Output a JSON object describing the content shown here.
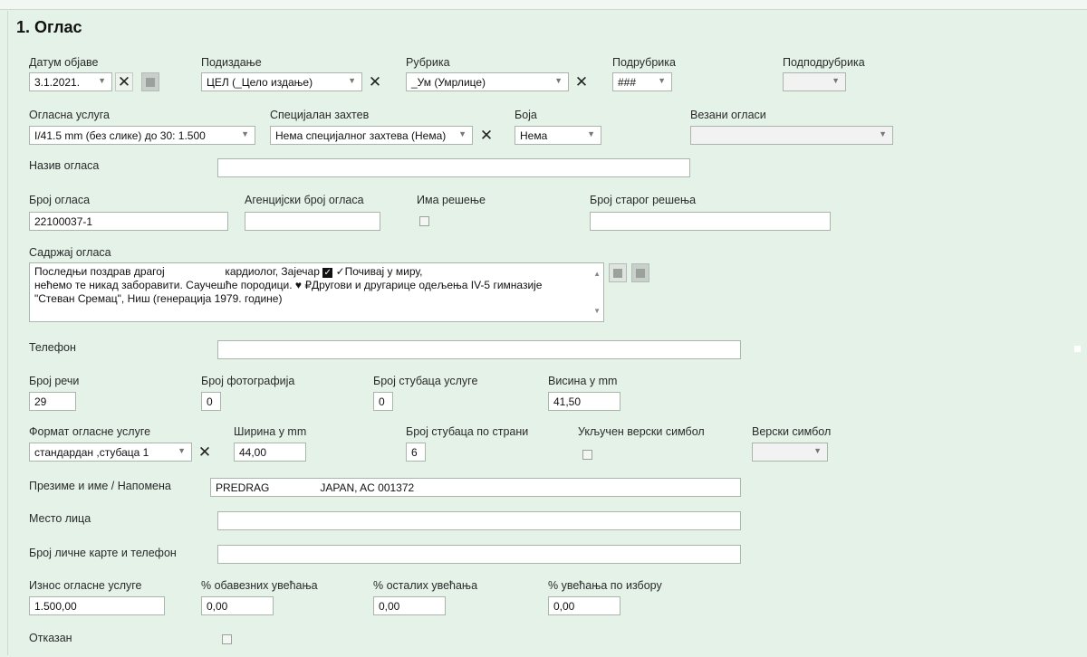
{
  "section": {
    "title": "1. Оглас"
  },
  "labels": {
    "datum_objave": "Датум објаве",
    "podizdanje": "Подиздање",
    "rubrika": "Рубрика",
    "podrubrika": "Подрубрика",
    "podpodrubrika": "Подподрубрика",
    "oglasna_usluga": "Огласна услуга",
    "specijalan_zahtev": "Специјалан захтев",
    "boja": "Боја",
    "vezani_oglasi": "Везани огласи",
    "naziv_oglasa": "Назив огласа",
    "broj_oglasa": "Број огласа",
    "agencijski_broj": "Агенцијски број огласа",
    "ima_resenje": "Има решење",
    "broj_starog_resenja": "Број старог решења",
    "sadrzaj_oglasa": "Садржај огласа",
    "telefon": "Телефон",
    "broj_reci": "Број речи",
    "broj_fotografija": "Број фотографија",
    "broj_stubaca_usluge": "Број стубаца услуге",
    "visina_mm": "Висина у mm",
    "format_oglasne_usluge": "Формат огласне услуге",
    "sirina_mm": "Ширина у mm",
    "broj_stubaca_po_strani": "Број стубаца по страни",
    "ukljucen_verski_simbol": "Укључен верски симбол",
    "verski_simbol": "Верски симбол",
    "prezime_ime": "Презиме и име / Напомена",
    "mesto_lica": "Место лица",
    "broj_licne_karte": "Број личне карте и телефон",
    "iznos_oglasne_usluge": "Износ огласне услуге",
    "obavezna_uvecanja": "% обавезних увећања",
    "ostala_uvecanja": "% осталих увећања",
    "uvecanja_po_izboru": "% увећања по избору",
    "otkazan": "Отказан"
  },
  "values": {
    "datum_objave": "3.1.2021.",
    "podizdanje": "ЦЕЛ (_Цело издање)",
    "rubrika": "_Ум (Умрлице)",
    "podrubrika": "###",
    "oglasna_usluga": "I/41.5 mm (без слике) до 30: 1.500",
    "specijalan_zahtev": "Нема специјалног захтева (Нема)",
    "boja": "Нема",
    "broj_oglasa": "22100037-1",
    "sadrzaj_part1": "Последњи поздрав драгој ",
    "sadrzaj_part1b": "кардиолог, Зајечар",
    "sadrzaj_part1c": "✓Почивај у миру,",
    "sadrzaj_line2": "нећемо те никад заборавити. Саучешће породици. ♥ ₽Другови и другарице одељења IV-5 гимназије",
    "sadrzaj_line3": "\"Стеван Сремац\", Ниш (генерација 1979. године)",
    "broj_reci": "29",
    "broj_fotografija": "0",
    "broj_stubaca_usluge": "0",
    "visina_mm": "41,50",
    "format_oglasne_usluge": "стандардан ,стубаца 1",
    "sirina_mm": "44,00",
    "broj_stubaca_po_strani": "6",
    "prezime_ime_a": "PREDRAG",
    "prezime_ime_b": "JAPAN, AC 001372",
    "iznos_oglasne_usluge": "1.500,00",
    "obavezna_uvecanja": "0,00",
    "ostala_uvecanja": "0,00",
    "uvecanja_po_izboru": "0,00"
  },
  "checkboxes": {
    "ima_resenje": false,
    "ukljucen_verski_simbol": false,
    "otkazan": false
  }
}
